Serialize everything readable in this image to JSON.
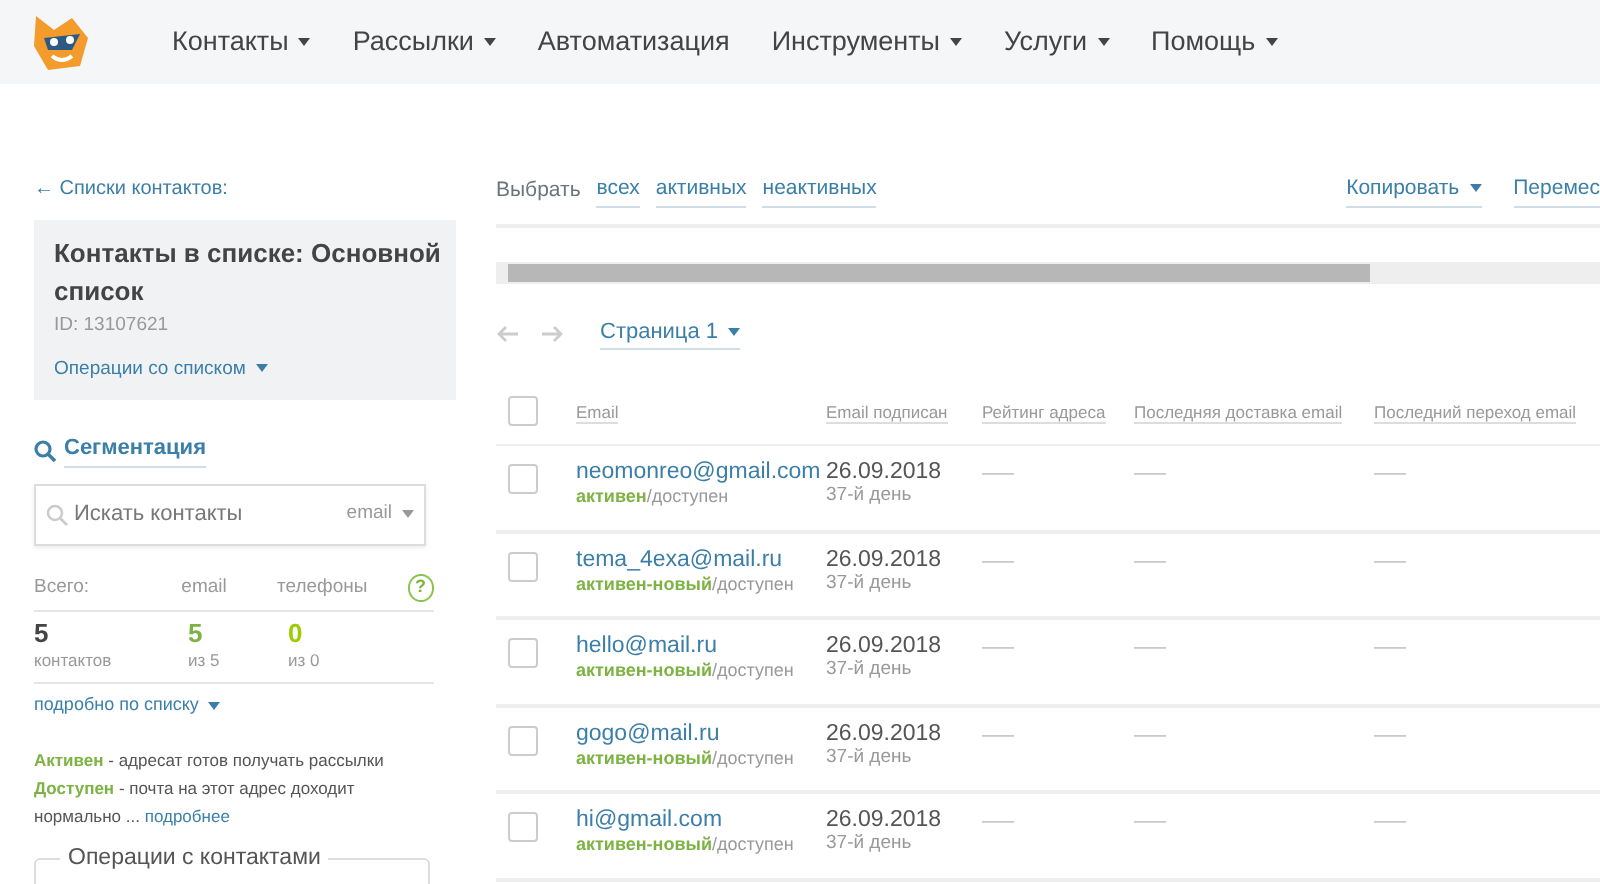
{
  "navbar": {
    "items": [
      {
        "label": "Контакты",
        "dropdown": true
      },
      {
        "label": "Рассылки",
        "dropdown": true
      },
      {
        "label": "Автоматизация",
        "dropdown": false
      },
      {
        "label": "Инструменты",
        "dropdown": true
      },
      {
        "label": "Услуги",
        "dropdown": true
      },
      {
        "label": "Помощь",
        "dropdown": true
      }
    ]
  },
  "sidebar": {
    "back_link": "← Списки контактов:",
    "list_card": {
      "title": "Контакты в списке: Основной список",
      "id": "ID: 13107621",
      "operations": "Операции со списком"
    },
    "segmentation": "Сегментация",
    "search": {
      "placeholder": "Искать контакты",
      "field_select": "email"
    },
    "stats": {
      "headers": [
        "Всего:",
        "email",
        "телефоны"
      ],
      "help": "?",
      "cells": [
        {
          "value": "5",
          "caption": "контактов",
          "kind": "total"
        },
        {
          "value": "5",
          "caption": "из 5",
          "kind": "email"
        },
        {
          "value": "0",
          "caption": "из 0",
          "kind": "phone"
        }
      ],
      "details_link": "подробно по списку"
    },
    "legend": [
      {
        "text": "**Активен** - адресат готов получать рассылки"
      },
      {
        "text": "**Доступен** - почта на этот адрес доходит нормально ... ",
        "link": "подробнее"
      }
    ],
    "operations_group": "Операции с контактами"
  },
  "toolbar": {
    "select_label": "Выбрать",
    "select_links": [
      "всех",
      "активных",
      "неактивных"
    ],
    "actions": [
      "Копировать",
      "Перемес"
    ]
  },
  "pager": {
    "page": "Страница 1"
  },
  "table": {
    "header_checked": false,
    "columns": [
      "Email",
      "Email подписан",
      "Рейтинг адреса",
      "Последняя доставка email",
      "Последний переход email"
    ],
    "rows": [
      {
        "checked": false,
        "email": "neomonreo@gmail.com",
        "status": "**активен**/доступен",
        "date": "26.09.2018",
        "age": "37-й день",
        "rating": "——",
        "delivery": "——",
        "click": "——"
      },
      {
        "checked": false,
        "email": "tema_4exa@mail.ru",
        "status": "**активен-новый**/доступен",
        "date": "26.09.2018",
        "age": "37-й день",
        "rating": "——",
        "delivery": "——",
        "click": "——"
      },
      {
        "checked": false,
        "email": "hello@mail.ru",
        "status": "**активен-новый**/доступен",
        "date": "26.09.2018",
        "age": "37-й день",
        "rating": "——",
        "delivery": "——",
        "click": "——"
      },
      {
        "checked": false,
        "email": "gogo@mail.ru",
        "status": "**активен-новый**/доступен",
        "date": "26.09.2018",
        "age": "37-й день",
        "rating": "——",
        "delivery": "——",
        "click": "——"
      },
      {
        "checked": false,
        "email": "hi@gmail.com",
        "status": "**активен-новый**/доступен",
        "date": "26.09.2018",
        "age": "37-й день",
        "rating": "——",
        "delivery": "——",
        "click": "——"
      }
    ]
  }
}
